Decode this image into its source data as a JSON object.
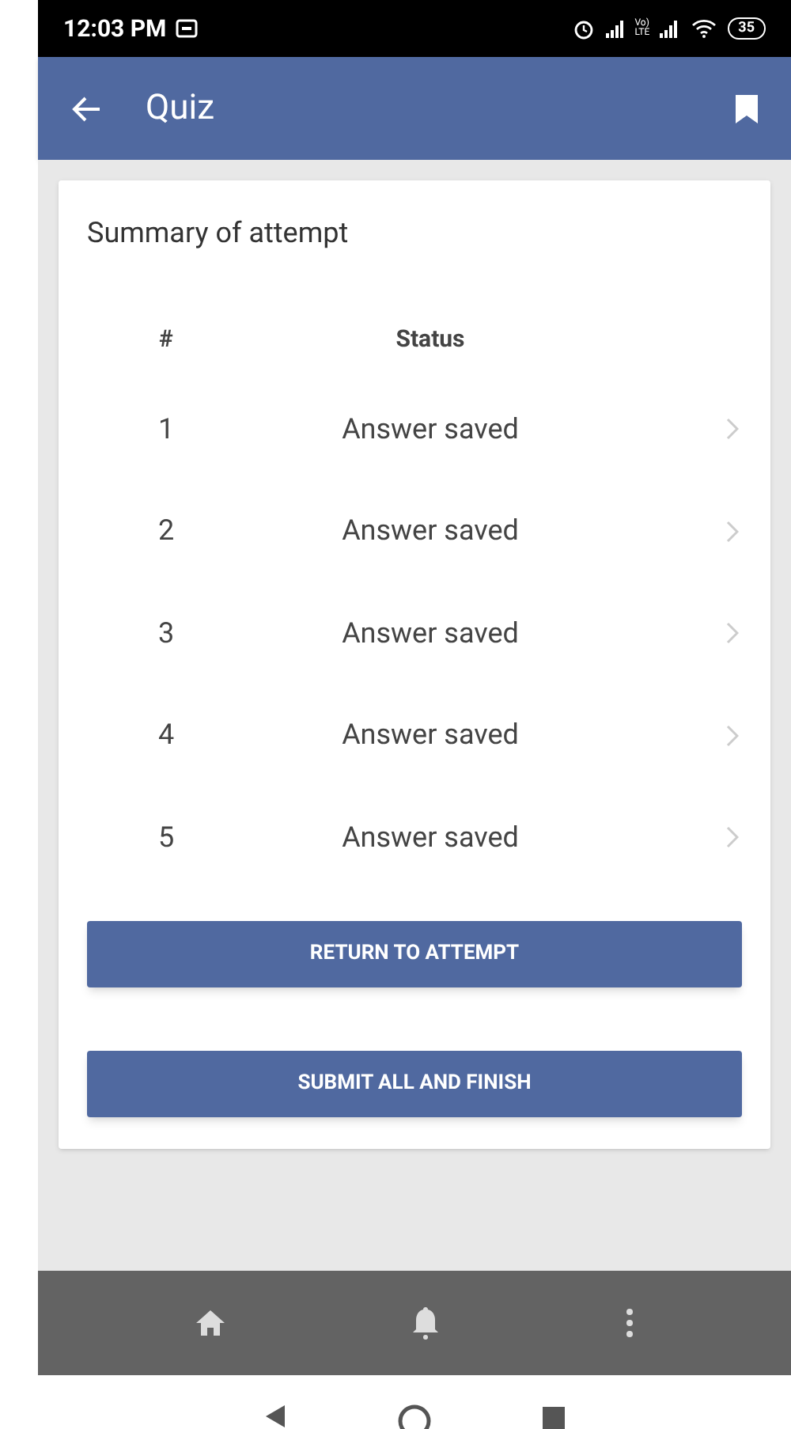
{
  "status_bar": {
    "time": "12:03 PM",
    "network_top": "Vo)",
    "network_bottom": "LTE",
    "battery": "35"
  },
  "app_bar": {
    "title": "Quiz"
  },
  "summary": {
    "title": "Summary of attempt",
    "columns": [
      "#",
      "Status"
    ],
    "rows": [
      {
        "number": "1",
        "status": "Answer saved"
      },
      {
        "number": "2",
        "status": "Answer saved"
      },
      {
        "number": "3",
        "status": "Answer saved"
      },
      {
        "number": "4",
        "status": "Answer saved"
      },
      {
        "number": "5",
        "status": "Answer saved"
      }
    ],
    "buttons": [
      "RETURN TO ATTEMPT",
      "SUBMIT ALL AND FINISH"
    ]
  }
}
